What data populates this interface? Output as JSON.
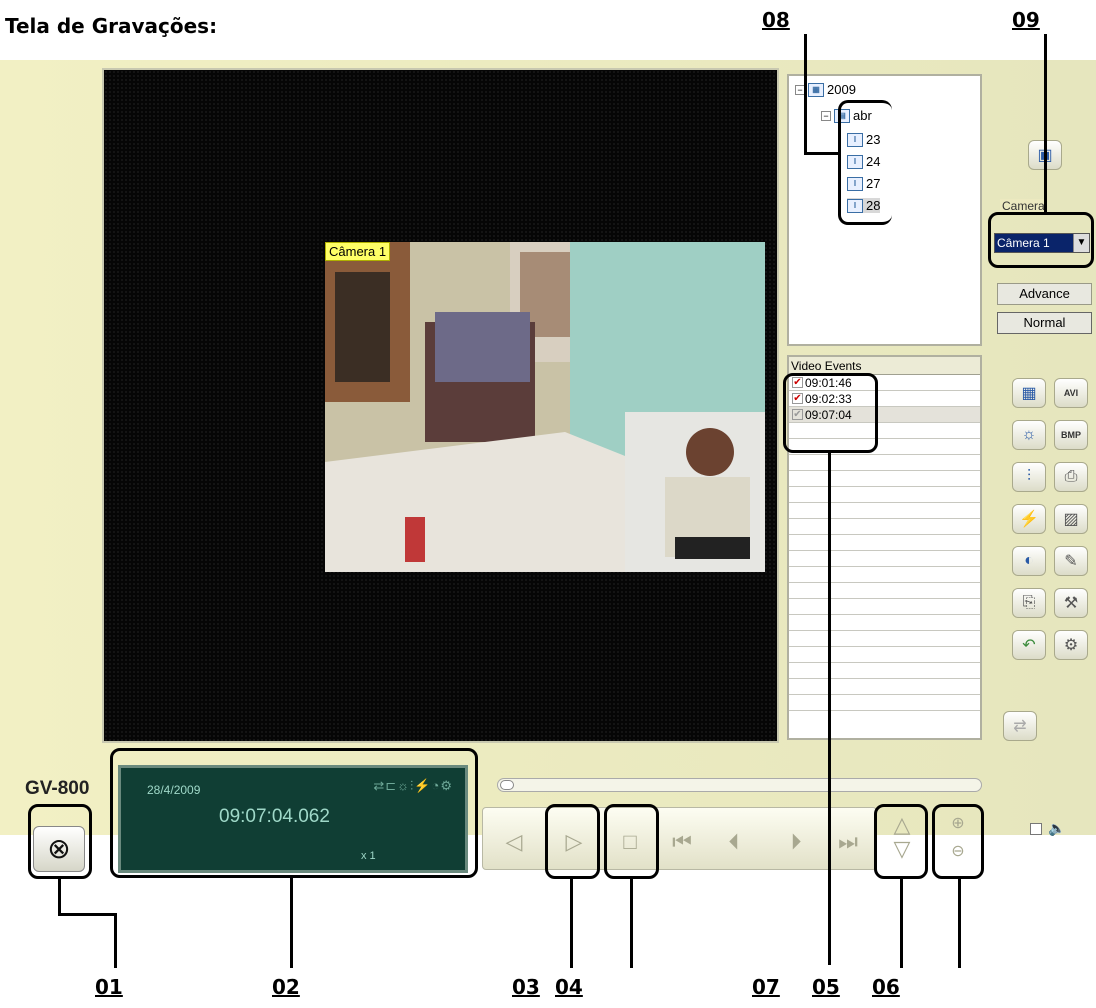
{
  "heading": "Tela de Gravações:",
  "callouts": {
    "top": [
      "08",
      "09"
    ],
    "bottom": [
      "01",
      "02",
      "03",
      "04",
      "07",
      "05",
      "06"
    ]
  },
  "video": {
    "camera_label": "Câmera 1"
  },
  "tree": {
    "year": "2009",
    "month": "abr",
    "days": [
      "23",
      "24",
      "27",
      "28"
    ],
    "selected_day": "28"
  },
  "events": {
    "header": "Video Events",
    "rows": [
      {
        "time": "09:01:46",
        "checked": true
      },
      {
        "time": "09:02:33",
        "checked": true
      },
      {
        "time": "09:07:04",
        "checked": false
      }
    ]
  },
  "camera": {
    "legend": "Camera",
    "selected": "Câmera 1"
  },
  "modes": {
    "advance": "Advance",
    "normal": "Normal"
  },
  "sidebar_buttons": {
    "avi": "AVI",
    "bmp": "BMP"
  },
  "player": {
    "model": "GV-800",
    "date": "28/4/2009",
    "time": "09:07:04.062",
    "speed": "x 1",
    "position": 0.0
  },
  "colors": {
    "lcd_bg": "#103e34",
    "panel_bg": "#ecebc0",
    "selection": "#0a246a"
  }
}
